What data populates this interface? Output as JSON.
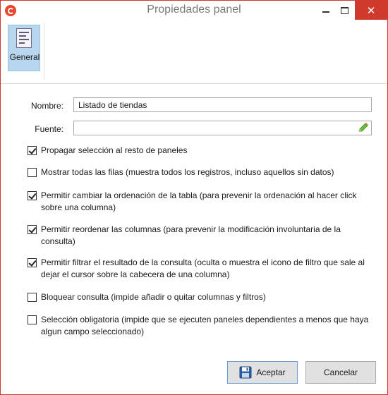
{
  "window": {
    "title": "Propiedades panel",
    "accent": "#d03a2c"
  },
  "ribbon": {
    "tab_label": "General",
    "tab_icon": "properties-list-icon"
  },
  "form": {
    "nombre_label": "Nombre:",
    "nombre_value": "Listado de tiendas",
    "fuente_label": "Fuente:",
    "fuente_value": "",
    "fuente_action_icon": "pencil-edit-icon"
  },
  "options": [
    {
      "label": "Propagar selección al resto de paneles",
      "checked": true
    },
    {
      "label": "Mostrar todas las filas (muestra todos los registros, incluso aquellos sin datos)",
      "checked": false
    },
    {
      "label": "Permitir cambiar la ordenación de la tabla (para prevenir la ordenación al hacer click sobre una columna)",
      "checked": true
    },
    {
      "label": "Permitir reordenar las columnas (para prevenir la modificación involuntaria de la consulta)",
      "checked": true
    },
    {
      "label": "Permitir filtrar el resultado de la consulta (oculta o muestra el icono de filtro que sale al dejar el cursor sobre la cabecera de una columna)",
      "checked": true
    },
    {
      "label": "Bloquear consulta (impide añadir o quitar columnas y filtros)",
      "checked": false
    },
    {
      "label": "Selección obligatoria (impide que se ejecuten paneles dependientes a menos que haya algun campo seleccionado)",
      "checked": false
    }
  ],
  "buttons": {
    "ok_label": "Aceptar",
    "ok_icon": "save-disk-icon",
    "cancel_label": "Cancelar"
  }
}
